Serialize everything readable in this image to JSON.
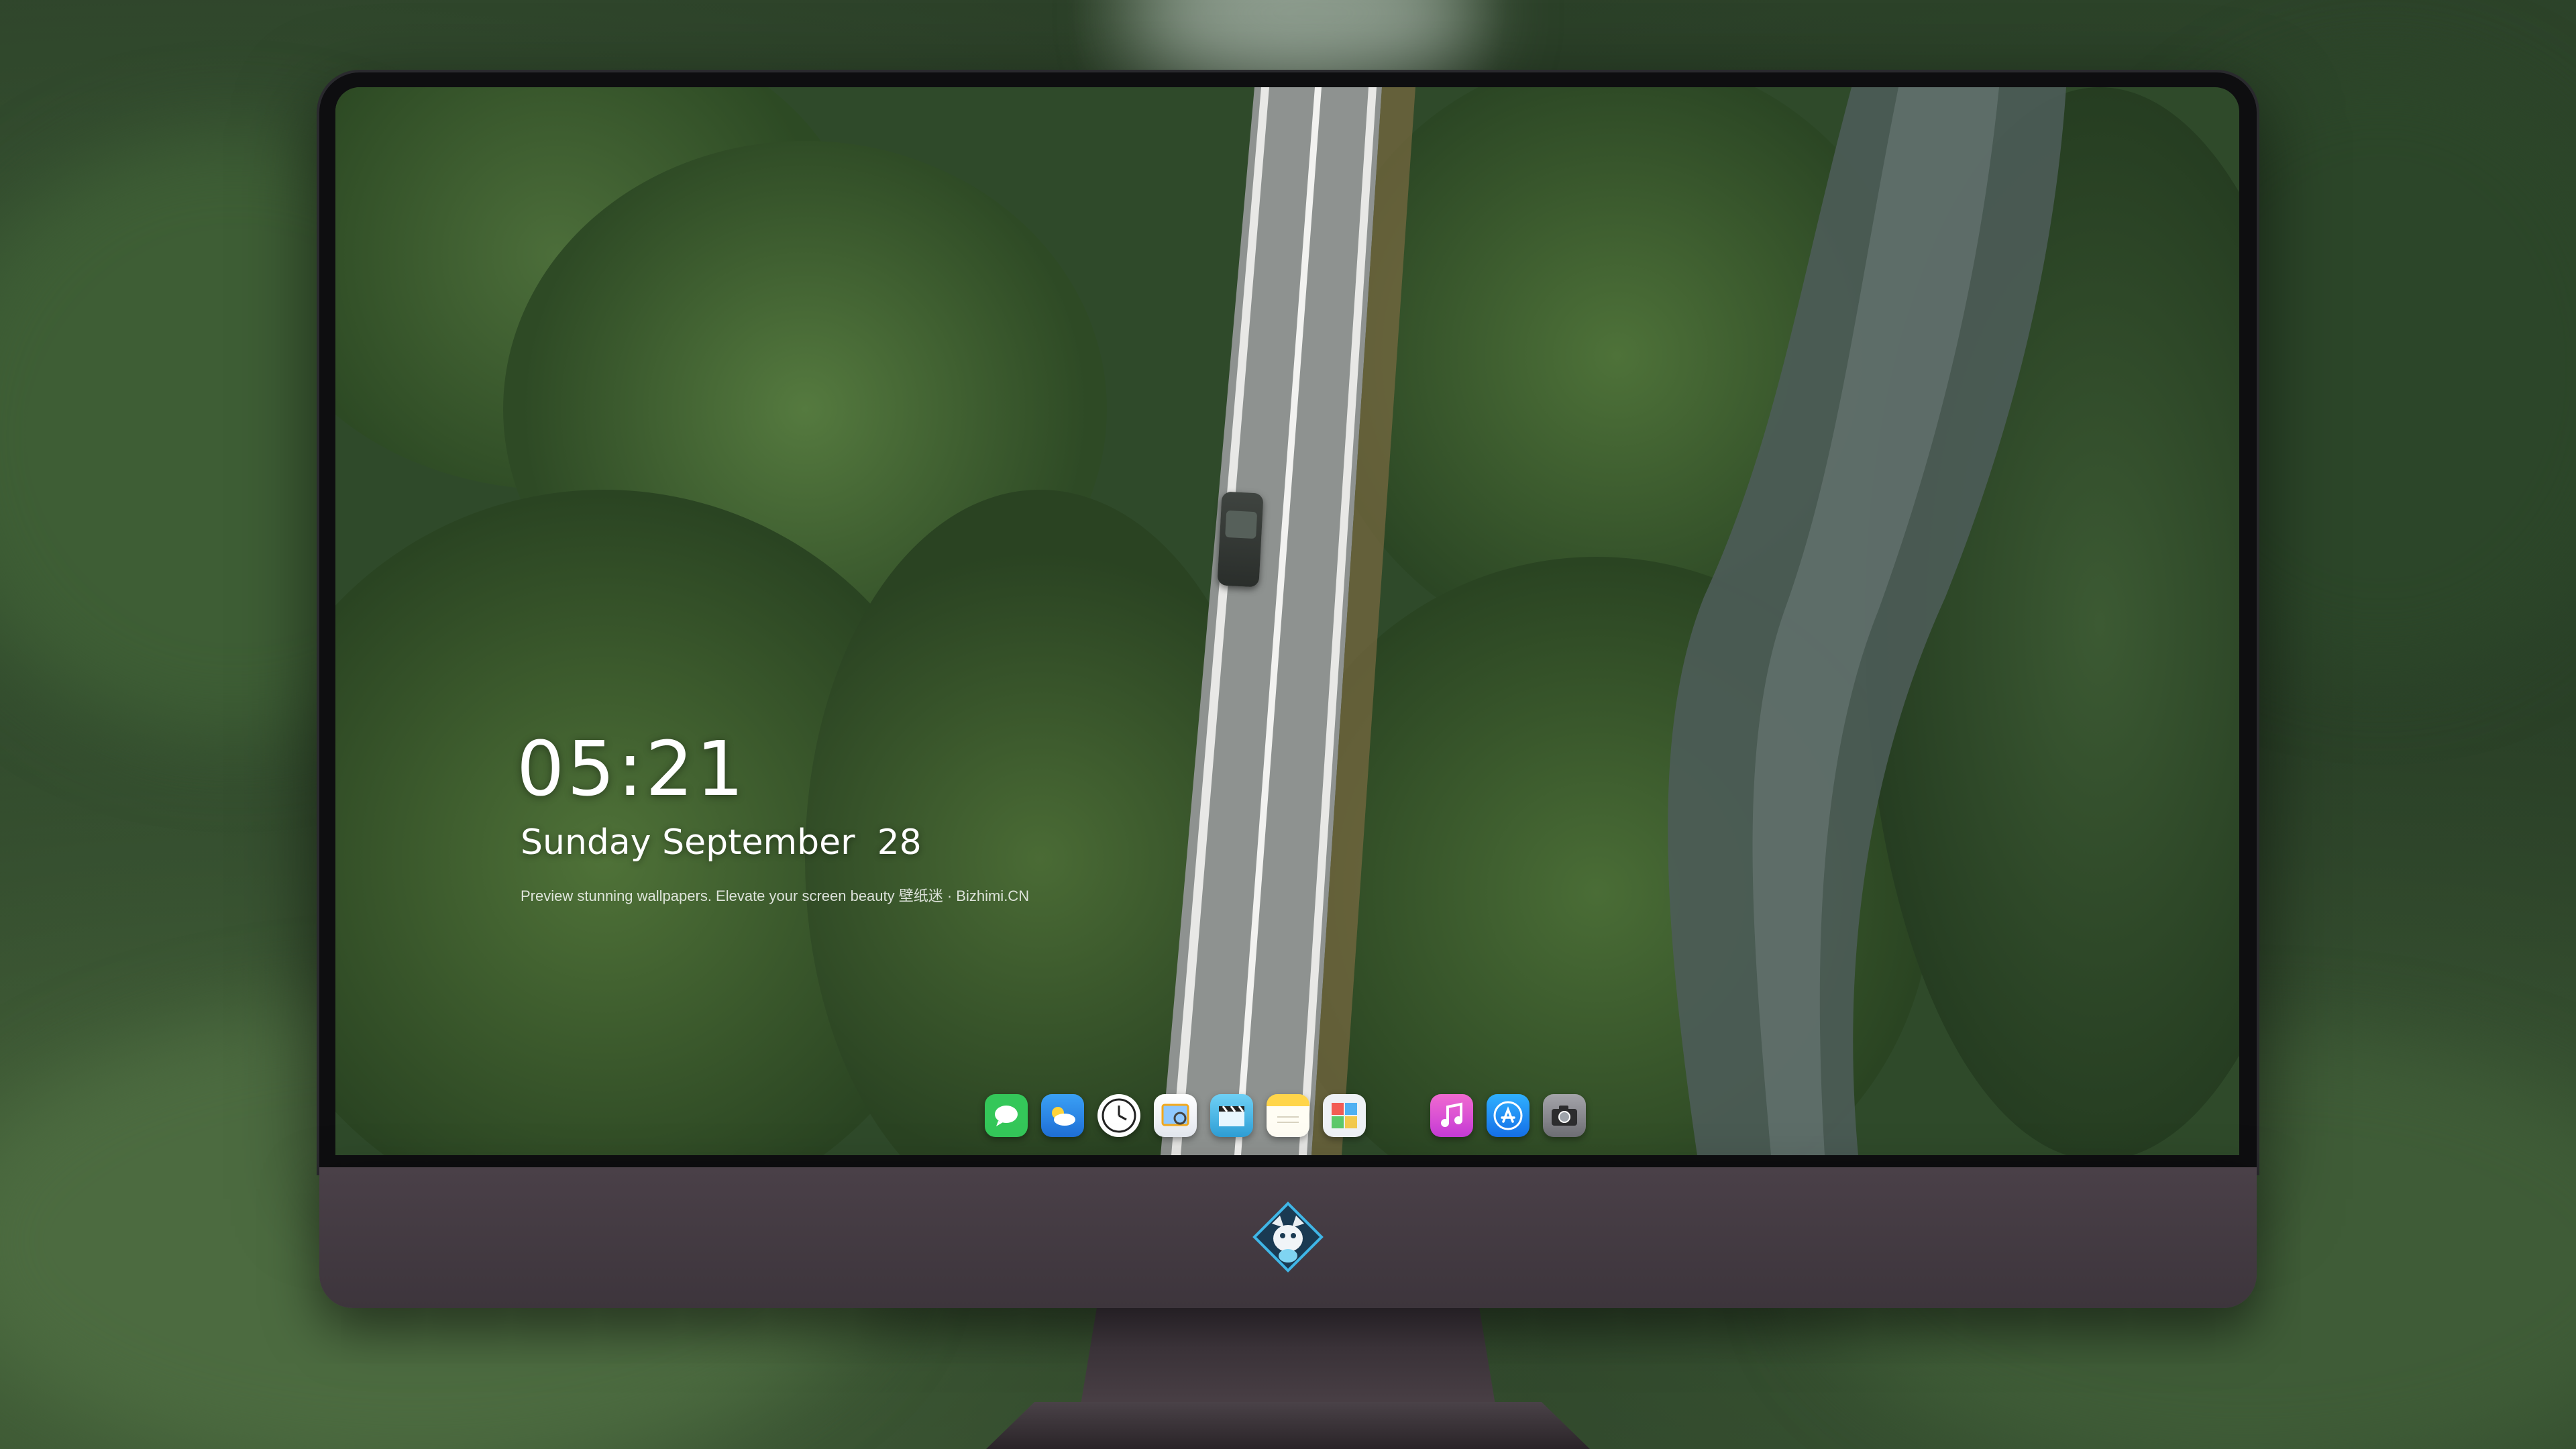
{
  "lock_screen": {
    "time": "05:21",
    "date": "Sunday September  28",
    "tagline": "Preview stunning wallpapers. Elevate your screen beauty 壁纸迷 · Bizhimi.CN"
  },
  "dock": {
    "apps": [
      {
        "name": "Messages",
        "icon": "messages-icon",
        "color": "#34c759"
      },
      {
        "name": "Weather",
        "icon": "weather-icon",
        "color": "#2f8cf0"
      },
      {
        "name": "Clock",
        "icon": "clock-icon",
        "color": "#ffffff"
      },
      {
        "name": "Preview",
        "icon": "preview-icon",
        "color": "#f2c94c"
      },
      {
        "name": "Video Editor",
        "icon": "clapperboard-icon",
        "color": "#4fc3e8"
      },
      {
        "name": "Notes",
        "icon": "notes-icon",
        "color": "#ffd54a"
      },
      {
        "name": "Photos",
        "icon": "photos-icon",
        "color": "#e0e6ee"
      },
      {
        "name": "Music",
        "icon": "music-icon",
        "color": "#e84ab8"
      },
      {
        "name": "App Store",
        "icon": "app-store-icon",
        "color": "#1d8ff2"
      },
      {
        "name": "Camera",
        "icon": "camera-icon",
        "color": "#8d8d92"
      }
    ]
  },
  "monitor": {
    "logo": "fox-logo-icon"
  }
}
